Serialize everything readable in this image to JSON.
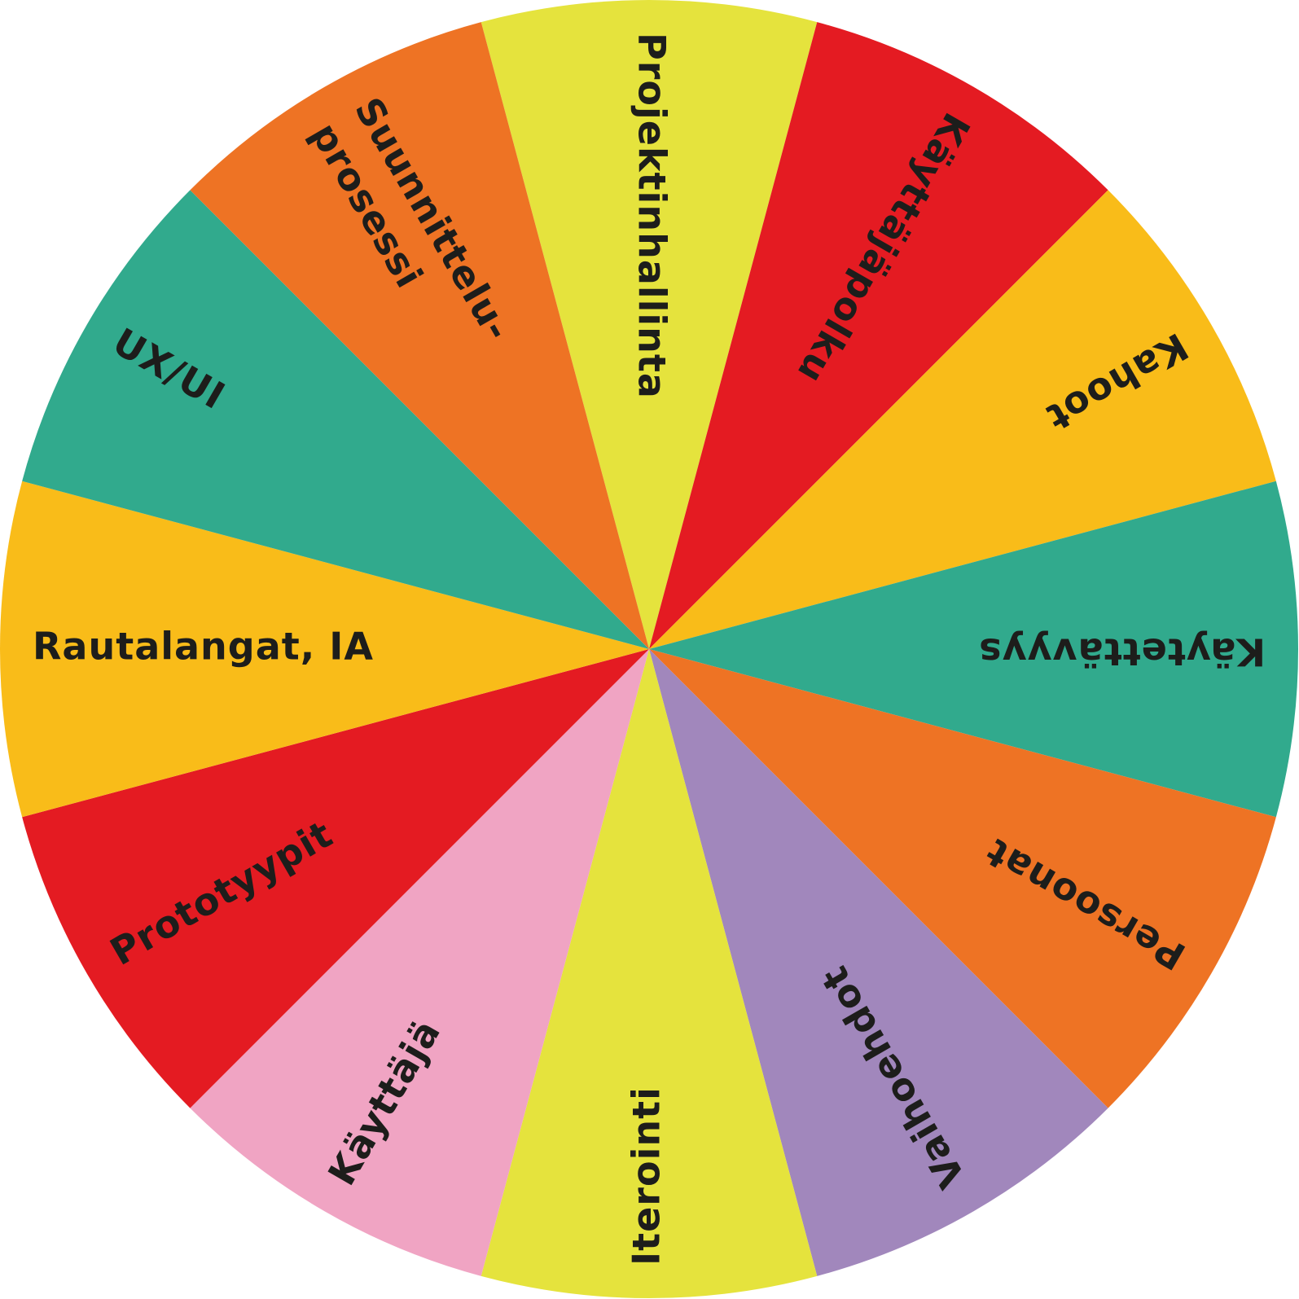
{
  "wheel": {
    "segments": [
      {
        "label": "Projektinhallinta",
        "color": "#E5E33D"
      },
      {
        "label": "Käyttäjäpolku",
        "color": "#E41B22"
      },
      {
        "label": "Kahoot",
        "color": "#F9BC19"
      },
      {
        "label": "Käytettävyys",
        "color": "#31AA8D"
      },
      {
        "label": "Persoonat",
        "color": "#EE7324"
      },
      {
        "label": "Vaihoehdot",
        "color": "#A187BC"
      },
      {
        "label": "Iterointi",
        "color": "#E5E33D"
      },
      {
        "label": "Käyttäjä",
        "color": "#F0A4C3"
      },
      {
        "label": "Prototyypit",
        "color": "#E41B22"
      },
      {
        "label": "Rautalangat, IA",
        "color": "#F9BC19"
      },
      {
        "label": "UX/UI",
        "color": "#31AA8D"
      },
      {
        "label": "Suunnittelu-prosessi",
        "color": "#EE7324"
      }
    ]
  }
}
